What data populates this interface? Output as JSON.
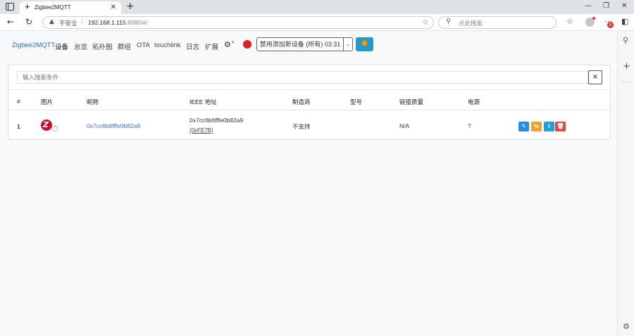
{
  "browser": {
    "tab_title": "Zigbee2MQTT",
    "insecure_label": "不安全",
    "url_host": "192.168.1.115",
    "url_rest": ":8080/#/",
    "search_placeholder": "点此搜索",
    "notification_count": "9"
  },
  "nav": {
    "brand": "Zigbee2MQTT",
    "links": [
      "设备",
      "总览",
      "拓扑图",
      "群组",
      "OTA",
      "touchlink",
      "日志",
      "扩展"
    ],
    "active": "设备",
    "permit_join_label": "禁用添加新设备 (所有) 03:31",
    "status_color": "#e51c23"
  },
  "devices": {
    "filter_placeholder": "输入搜索条件",
    "clear_label": "×",
    "columns": [
      "#",
      "图片",
      "昵称",
      "IEEE 地址",
      "制造商",
      "型号",
      "链接质量",
      "电源"
    ],
    "rows": [
      {
        "index": "1",
        "friendly_name": "0x7cc6b6fffe0b82a9",
        "ieee": "0x7cc6b6fffe0b82a9",
        "network_address": "(0xFE7B)",
        "manufacturer": "不支持",
        "model": "",
        "lqi": "N/A",
        "power": "?"
      }
    ],
    "action_colors": {
      "edit": "#2c8be0",
      "reconfigure": "#f0a030",
      "info": "#1ea0d8",
      "delete": "#e04848"
    }
  }
}
